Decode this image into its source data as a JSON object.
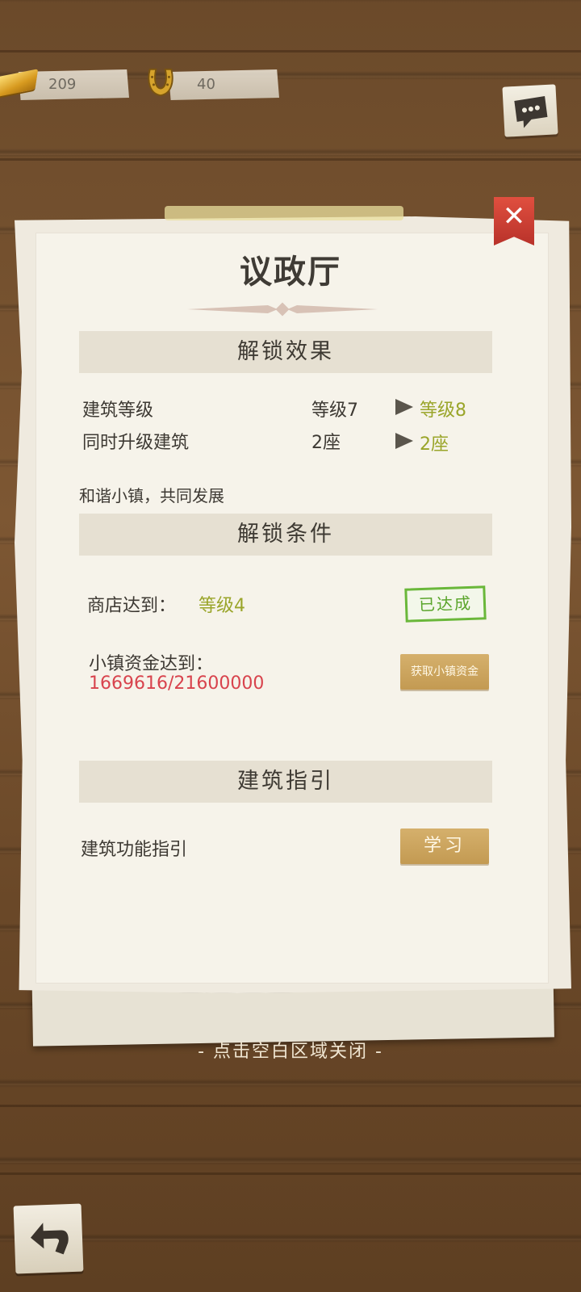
{
  "resources": {
    "gold": {
      "icon": "gold-bar-icon",
      "value": "209"
    },
    "horseshoe": {
      "icon": "horseshoe-icon",
      "value": "40"
    }
  },
  "panel": {
    "title": "议政厅",
    "close_icon": "close-icon",
    "close_glyph": "✕"
  },
  "unlock_effect": {
    "heading": "解锁效果",
    "rows": [
      {
        "label": "建筑等级",
        "current": "等级7",
        "next": "等级8"
      },
      {
        "label": "同时升级建筑",
        "current": "2座",
        "next": "2座"
      }
    ],
    "slogan": "和谐小镇，共同发展"
  },
  "unlock_conditions": {
    "heading": "解锁条件",
    "shop": {
      "label": "商店达到：",
      "value": "等级4",
      "status": "已达成"
    },
    "funds": {
      "label": "小镇资金达到：",
      "value": "1669616/21600000",
      "button": "获取小镇资金"
    }
  },
  "guide": {
    "heading": "建筑指引",
    "row_label": "建筑功能指引",
    "button": "学习"
  },
  "hint": "- 点击空白区域关闭 -",
  "colors": {
    "green": "#9aa52a",
    "red": "#d8434d",
    "done_green": "#5aa52b",
    "gold_button": "#c9a35c",
    "close_red": "#d0443a"
  }
}
